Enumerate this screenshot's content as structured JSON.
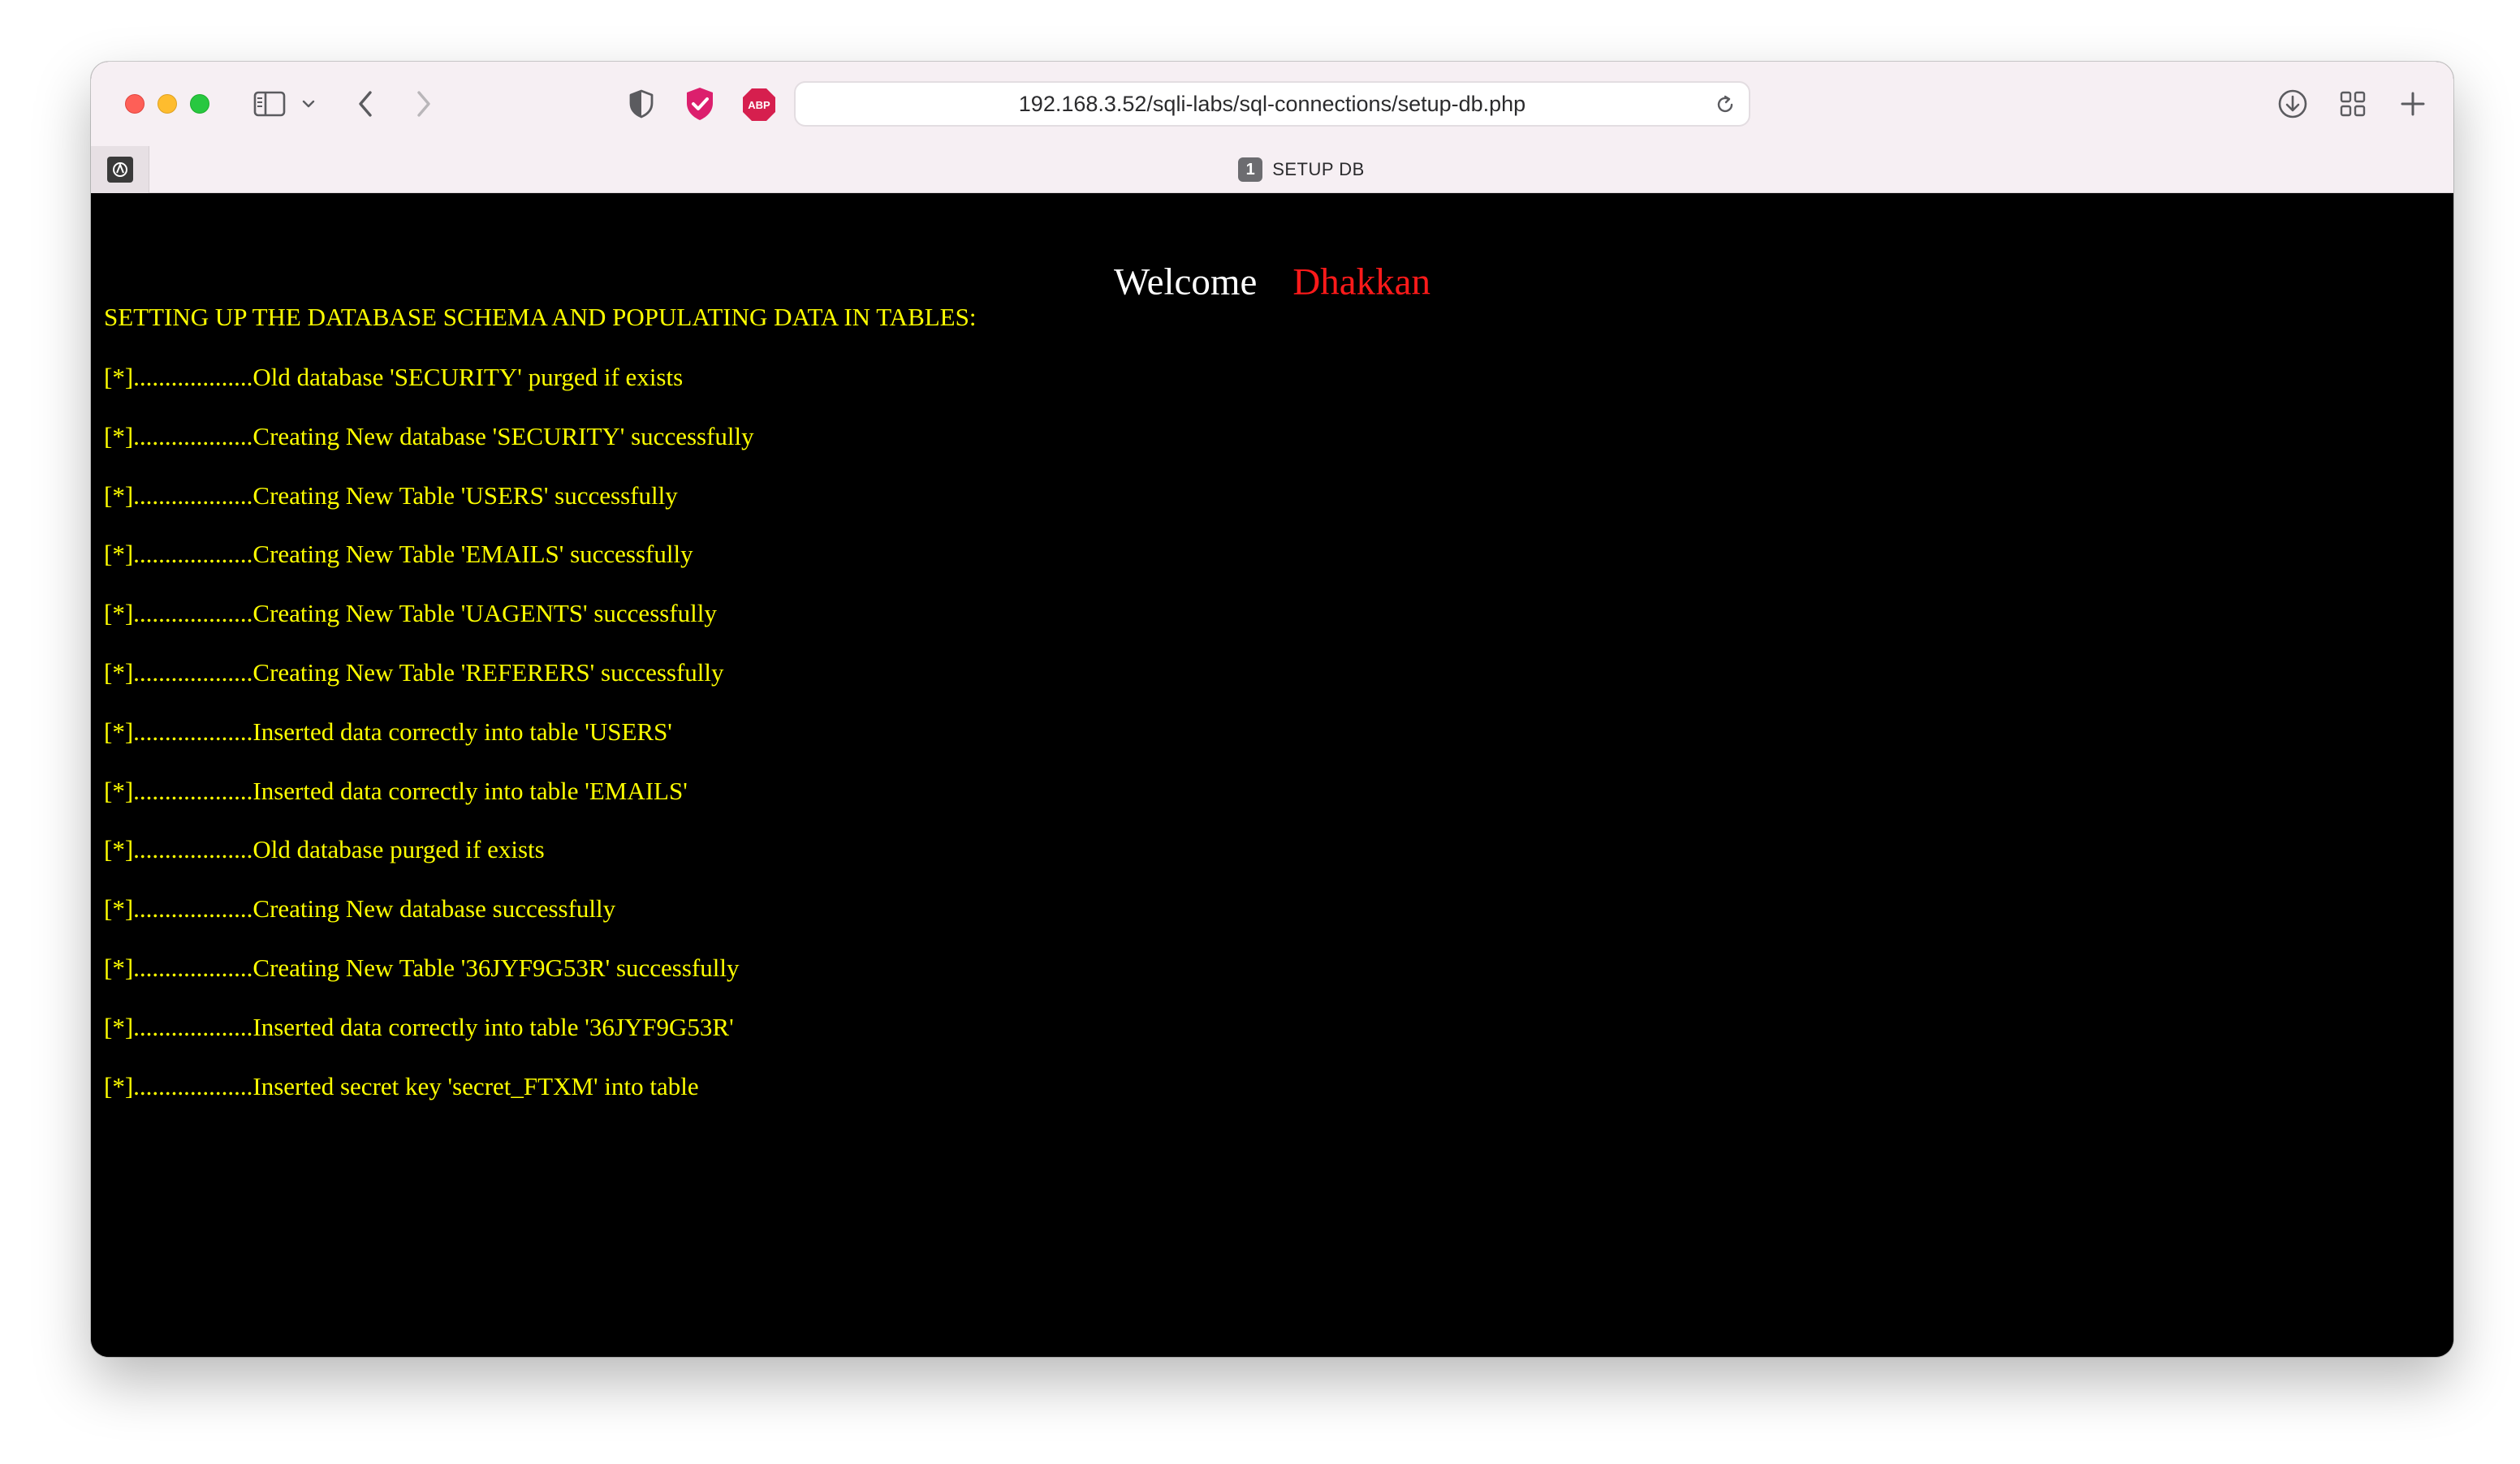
{
  "browser": {
    "address_url": "192.168.3.52/sqli-labs/sql-connections/setup-db.php",
    "extension_abp_label": "ABP",
    "tab": {
      "badge": "1",
      "title": "SETUP DB"
    }
  },
  "page": {
    "welcome": "Welcome",
    "name": "Dhakkan",
    "heading": "SETTING UP THE DATABASE SCHEMA AND POPULATING DATA IN TABLES:",
    "log_lines": [
      "[*]...................Old database 'SECURITY' purged if exists",
      "[*]...................Creating New database 'SECURITY' successfully",
      "[*]...................Creating New Table 'USERS' successfully",
      "[*]...................Creating New Table 'EMAILS' successfully",
      "[*]...................Creating New Table 'UAGENTS' successfully",
      "[*]...................Creating New Table 'REFERERS' successfully",
      "[*]...................Inserted data correctly into table 'USERS'",
      "[*]...................Inserted data correctly into table 'EMAILS'",
      "[*]...................Old database purged if exists",
      "[*]...................Creating New database successfully",
      "[*]...................Creating New Table '36JYF9G53R' successfully",
      "[*]...................Inserted data correctly into table '36JYF9G53R'",
      "[*]...................Inserted secret key 'secret_FTXM' into table"
    ]
  },
  "icons": {
    "sidebar": "sidebar-icon",
    "back": "chevron-left-icon",
    "forward": "chevron-right-icon",
    "privacy": "shield-icon",
    "extension": "checkmark-shield-icon",
    "reload": "reload-icon",
    "downloads": "download-icon",
    "tab_overview": "grid-icon",
    "new_tab": "plus-icon"
  },
  "colors": {
    "page_background": "#000000",
    "log_text": "#ffff00",
    "welcome_text": "#ffffff",
    "name_text": "#ff1a1a",
    "browser_chrome": "#f6eff3"
  }
}
